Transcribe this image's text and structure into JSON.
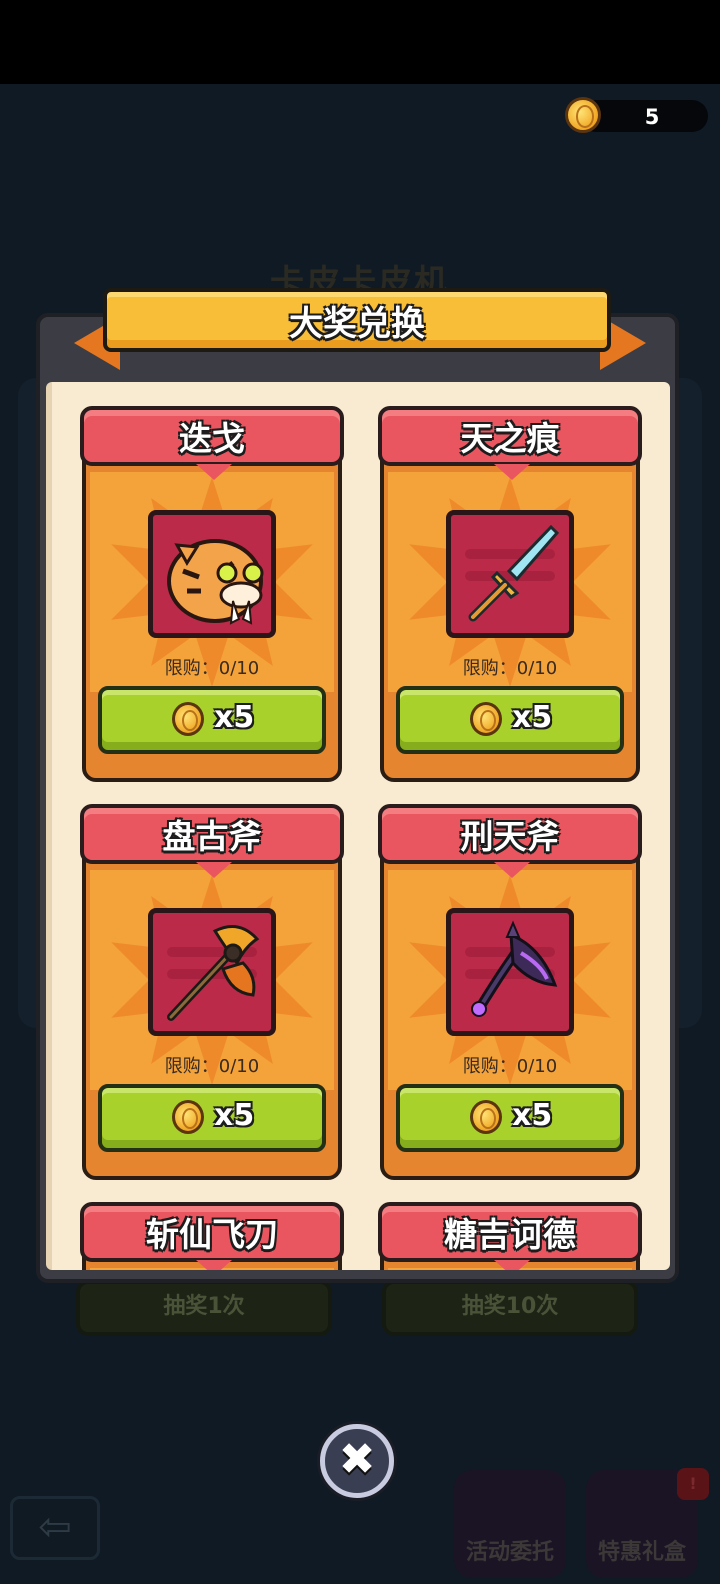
{
  "currency": {
    "amount": "5",
    "icon": "gold-coin-icon"
  },
  "background": {
    "title": "卡皮卡皮机",
    "buttons": [
      "抽奖1次",
      "抽奖10次"
    ],
    "menu": [
      "活动委托",
      "特惠礼盒"
    ],
    "badge": "!"
  },
  "modal": {
    "title": "大奖兑换",
    "close_icon": "close-icon",
    "items": [
      {
        "name": "迭戈",
        "limit": "限购：0/10",
        "cost": "x5",
        "icon": "tiger-walrus-pet-icon"
      },
      {
        "name": "天之痕",
        "limit": "限购：0/10",
        "cost": "x5",
        "icon": "crystal-sword-icon"
      },
      {
        "name": "盘古斧",
        "limit": "限购：0/10",
        "cost": "x5",
        "icon": "golden-axe-icon"
      },
      {
        "name": "刑天斧",
        "limit": "限购：0/10",
        "cost": "x5",
        "icon": "purple-axe-icon"
      },
      {
        "name": "斩仙飞刀"
      },
      {
        "name": "糖吉诃德"
      }
    ]
  },
  "colors": {
    "card_header": "#ea5660",
    "buy_button": "#a8d12b",
    "banner": "#f9be38"
  }
}
